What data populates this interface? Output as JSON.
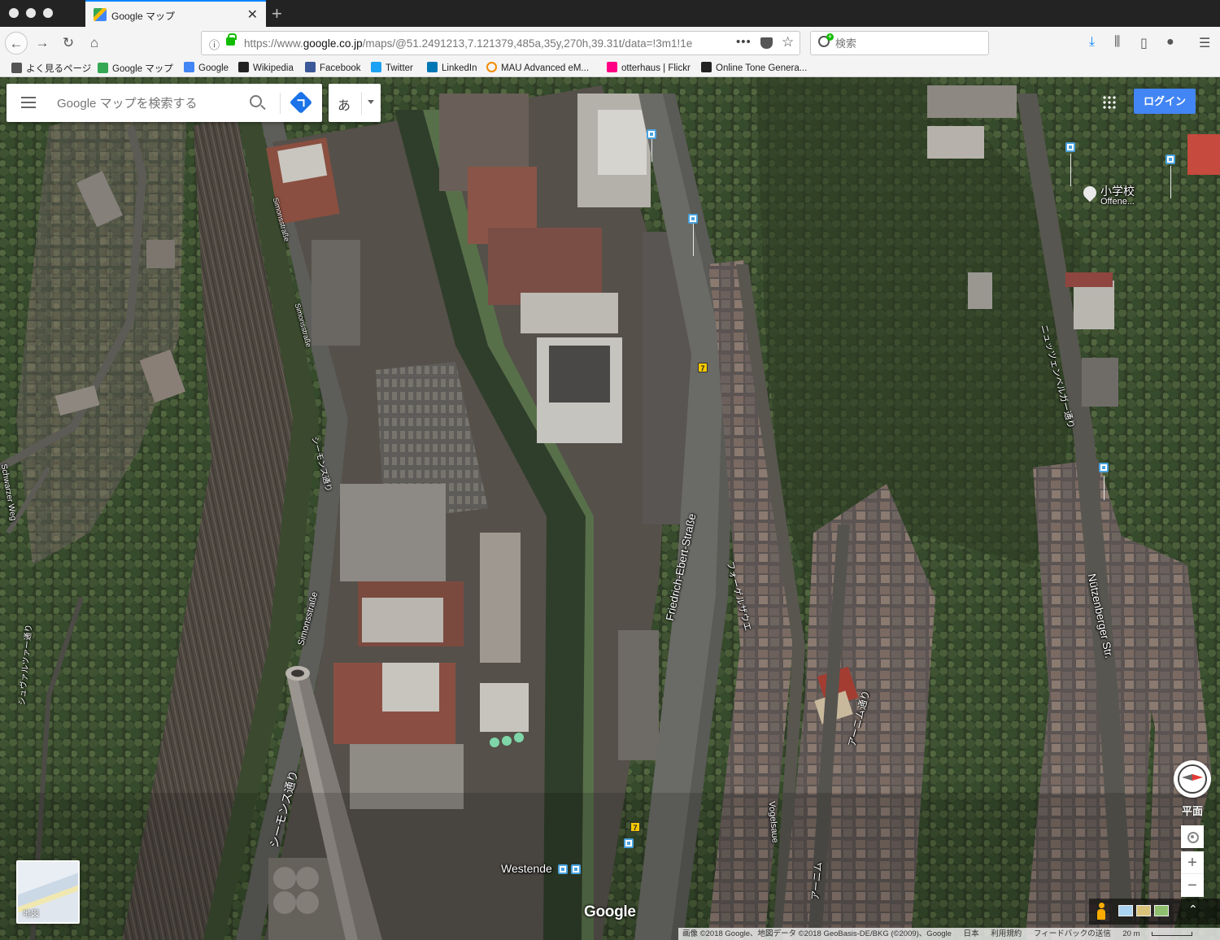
{
  "browser": {
    "tab_title": "Google マップ",
    "tab_close": "✕",
    "new_tab": "+",
    "url_prefix": "https://www.",
    "url_host": "google.co.jp",
    "url_rest": "/maps/@51.2491213,7.121379,485a,35y,270h,39.31t/data=!3m1!1e",
    "url_more": "•••",
    "search_placeholder": "検索",
    "bookmarks": [
      {
        "label": "よく見るページ",
        "icon": "gear-icon",
        "color": "#555555"
      },
      {
        "label": "Google マップ",
        "icon": "maps-icon",
        "color": "#34a853"
      },
      {
        "label": "Google",
        "icon": "google-icon",
        "color": "#4285f4"
      },
      {
        "label": "Wikipedia",
        "icon": "wikipedia-icon",
        "color": "#222222"
      },
      {
        "label": "Facebook",
        "icon": "facebook-icon",
        "color": "#3b5998"
      },
      {
        "label": "Twitter",
        "icon": "twitter-icon",
        "color": "#1da1f2"
      },
      {
        "label": "LinkedIn",
        "icon": "linkedin-icon",
        "color": "#0077b5"
      },
      {
        "label": "MAU Advanced eM...",
        "icon": "circle-icon",
        "color": "#f28b00"
      },
      {
        "label": "otterhaus | Flickr",
        "icon": "flickr-icon",
        "color": "#ff0084"
      },
      {
        "label": "Online Tone Genera...",
        "icon": "wave-icon",
        "color": "#222222"
      }
    ]
  },
  "maps": {
    "search_placeholder": "Google マップを検索する",
    "ime_label": "あ",
    "login_label": "ログイン",
    "thumbnail_label": "地図",
    "tilt_label": "平面",
    "zoom_in": "+",
    "zoom_out": "−",
    "expand": "⌃",
    "logo": "Google",
    "attribution": [
      "画像 ©2018 Google、地図データ ©2018 GeoBasis-DE/BKG (©2009)、Google",
      "日本",
      "利用規約",
      "フィードバックの送信",
      "20 m"
    ],
    "labels": {
      "friedrich": "Friedrich-Ebert-Straße",
      "nuetzen": "Nützenberger Str.",
      "simons1": "Simonsstraße",
      "simons2": "Simonsstraße",
      "simons3": "Simonsstraße",
      "siemens": "シーモンス通り",
      "siemens2": "シーモンス通り",
      "schwarzer": "Schwarzer Weg",
      "schwarzer_jp": "シュヴァルツァー通り",
      "vogel": "Vogelsaue",
      "vogel_jp": "フォーゲルザウエ",
      "nuetzen_jp": "ニュッツェンベルガー通り",
      "arnim": "アーニム通り",
      "arnim2": "アーニム",
      "school": "小学校",
      "school_sub": "Offene...",
      "westende": "Westende",
      "bus7": "7"
    }
  }
}
